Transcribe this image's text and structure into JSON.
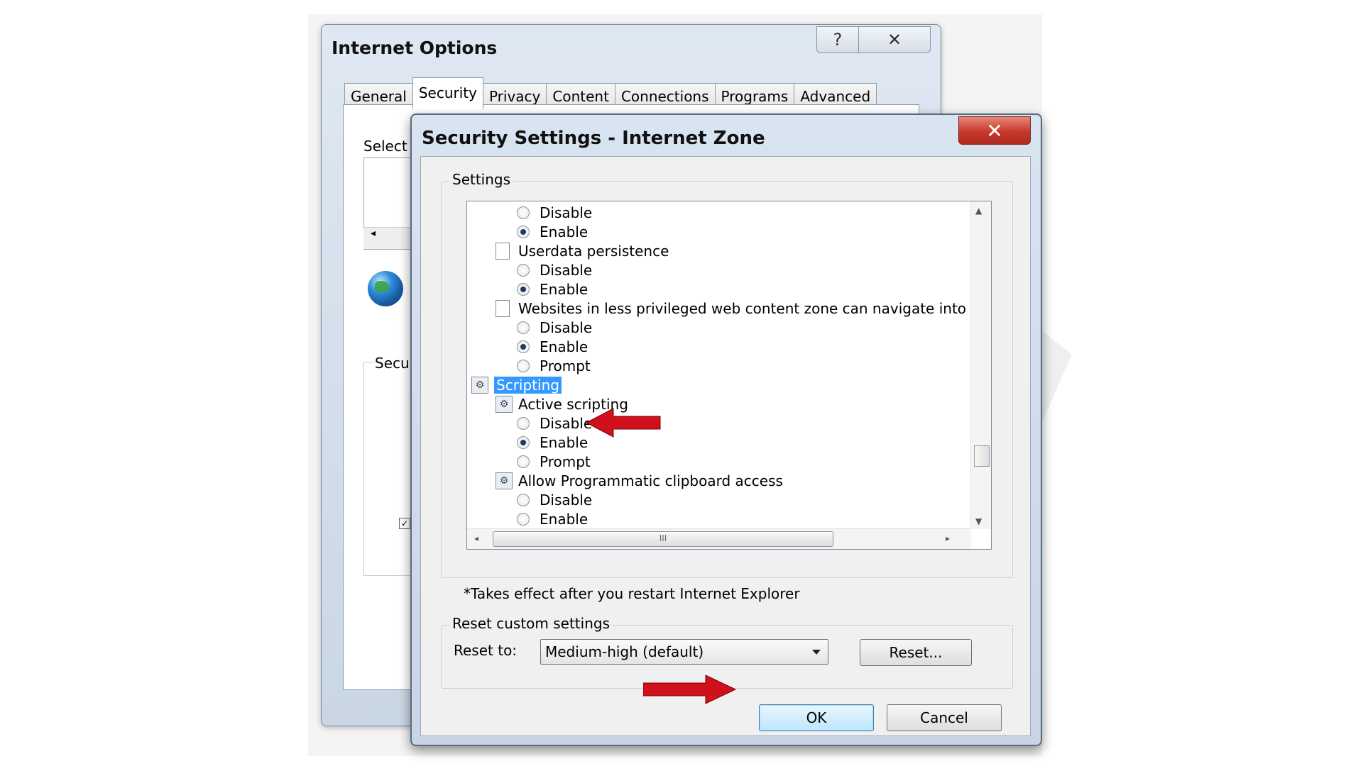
{
  "internet_options": {
    "title": "Internet Options",
    "help_icon_glyph": "?",
    "close_icon_glyph": "✕",
    "tabs": [
      "General",
      "Security",
      "Privacy",
      "Content",
      "Connections",
      "Programs",
      "Advanced"
    ],
    "active_tab": "Security",
    "select_label_partial": "Select",
    "security_label_partial": "Secu",
    "scroll_left_glyph": "◂"
  },
  "security_settings": {
    "title": "Security Settings - Internet Zone",
    "close_glyph": "✕",
    "settings_label": "Settings",
    "tree_rows": [
      {
        "kind": "radio",
        "label": "Disable",
        "checked": false,
        "indent": 2
      },
      {
        "kind": "radio",
        "label": "Enable",
        "checked": true,
        "indent": 2
      },
      {
        "kind": "item",
        "label": "Userdata persistence",
        "indent": 1
      },
      {
        "kind": "radio",
        "label": "Disable",
        "checked": false,
        "indent": 2
      },
      {
        "kind": "radio",
        "label": "Enable",
        "checked": true,
        "indent": 2
      },
      {
        "kind": "item",
        "label": "Websites in less privileged web content zone can navigate into",
        "indent": 1
      },
      {
        "kind": "radio",
        "label": "Disable",
        "checked": false,
        "indent": 2
      },
      {
        "kind": "radio",
        "label": "Enable",
        "checked": true,
        "indent": 2
      },
      {
        "kind": "radio",
        "label": "Prompt",
        "checked": false,
        "indent": 2
      },
      {
        "kind": "category",
        "label": "Scripting",
        "selected": true,
        "indent": 0
      },
      {
        "kind": "subcategory",
        "label": "Active scripting",
        "indent": 1
      },
      {
        "kind": "radio",
        "label": "Disable",
        "checked": false,
        "indent": 2
      },
      {
        "kind": "radio",
        "label": "Enable",
        "checked": true,
        "indent": 2
      },
      {
        "kind": "radio",
        "label": "Prompt",
        "checked": false,
        "indent": 2
      },
      {
        "kind": "subcategory",
        "label": "Allow Programmatic clipboard access",
        "indent": 1
      },
      {
        "kind": "radio",
        "label": "Disable",
        "checked": false,
        "indent": 2
      },
      {
        "kind": "radio",
        "label": "Enable",
        "checked": false,
        "indent": 2
      }
    ],
    "scroll_up_glyph": "▲",
    "scroll_down_glyph": "▼",
    "scroll_left_glyph": "◂",
    "scroll_right_glyph": "▸",
    "hscroll_grip": "III",
    "note": "*Takes effect after you restart Internet Explorer",
    "reset_group_label": "Reset custom settings",
    "reset_to_label": "Reset to:",
    "reset_to_value": "Medium-high (default)",
    "reset_button": "Reset...",
    "ok_button": "OK",
    "cancel_button": "Cancel"
  },
  "colors": {
    "arrow": "#d0101a",
    "selection": "#3399ff",
    "close_button": "#c6382a"
  }
}
